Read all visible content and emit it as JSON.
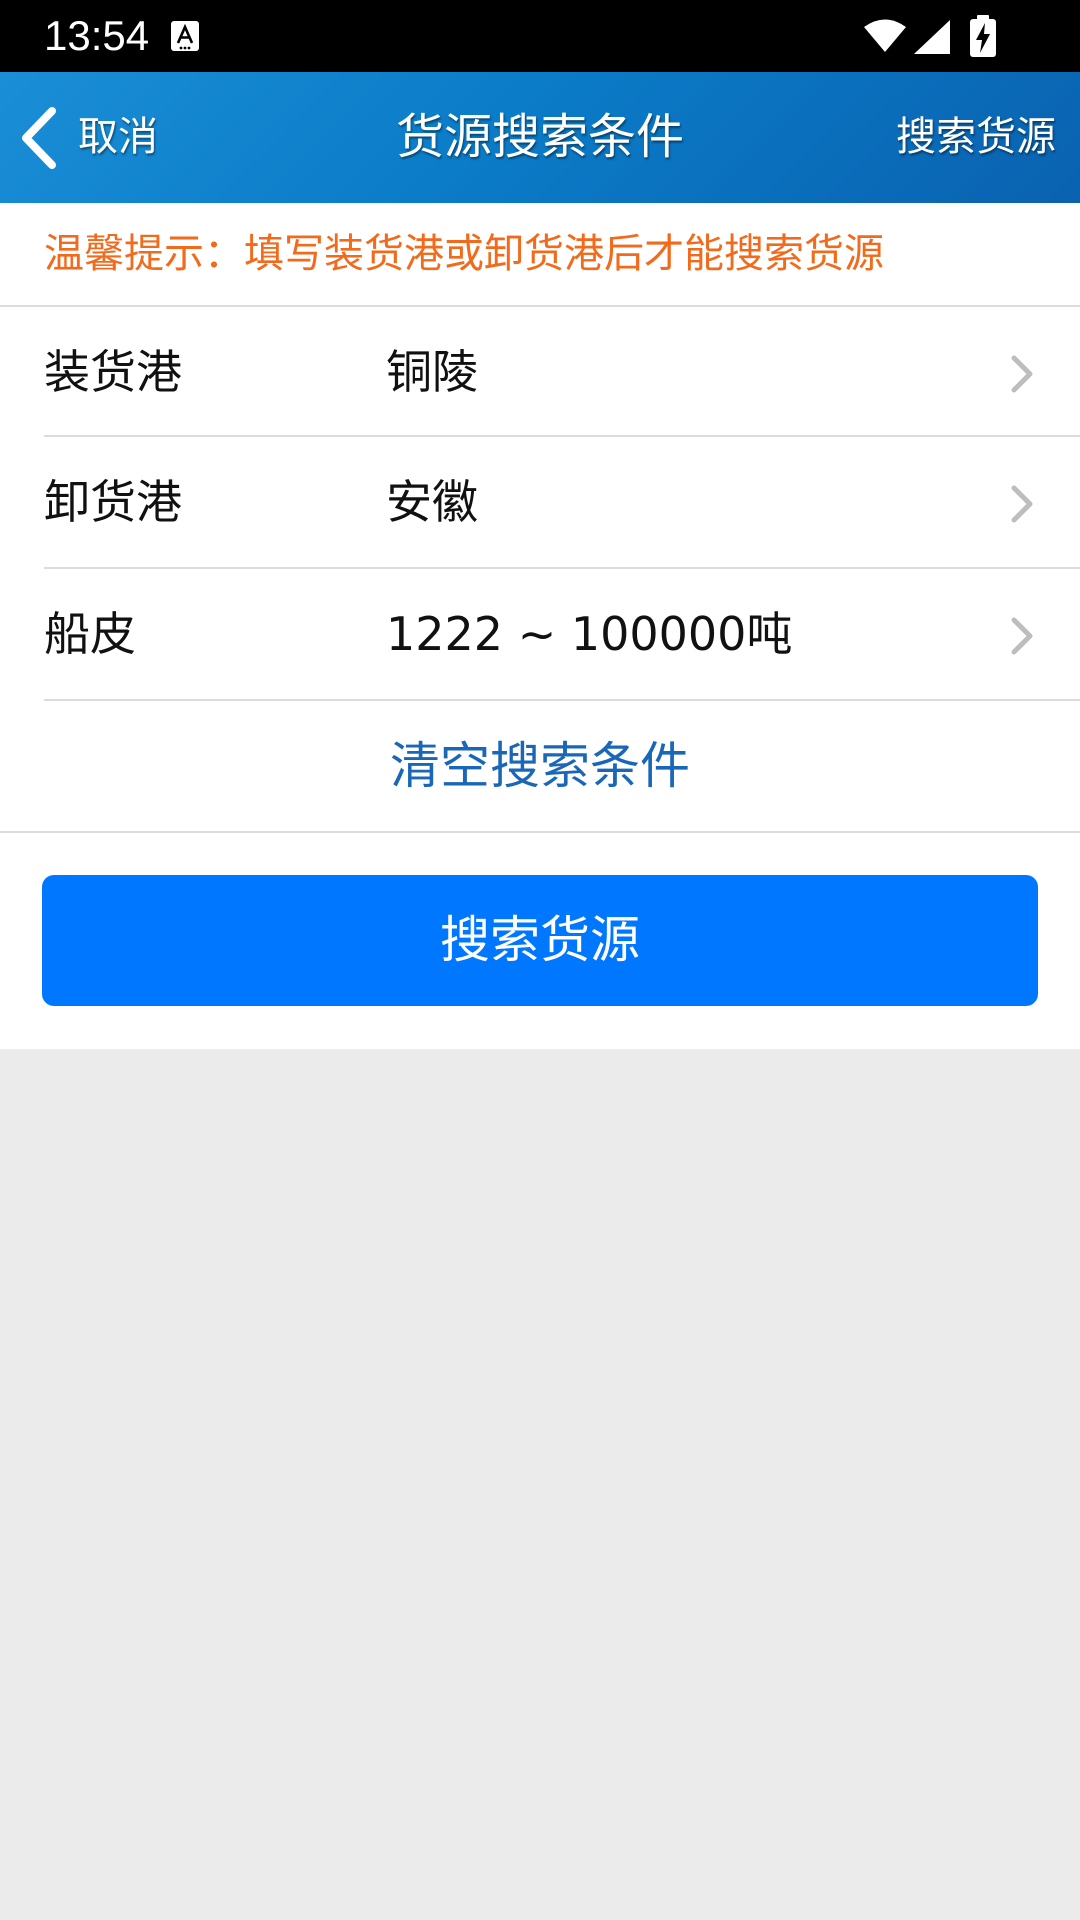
{
  "status_bar": {
    "time": "13:54",
    "icons": [
      "text-a-icon",
      "wifi-icon",
      "cell-signal-icon",
      "battery-charging-icon"
    ]
  },
  "header": {
    "back_label": "取消",
    "title": "货源搜索条件",
    "action_label": "搜索货源",
    "back_icon": "chevron-left-icon"
  },
  "tip": {
    "text": "温馨提示：填写装货港或卸货港后才能搜索货源"
  },
  "form": {
    "rows": [
      {
        "label": "装货港",
        "value": "铜陵",
        "icon": "chevron-right-icon"
      },
      {
        "label": "卸货港",
        "value": "安徽",
        "icon": "chevron-right-icon"
      },
      {
        "label": "船皮",
        "value": "1222 ~ 100000吨",
        "icon": "chevron-right-icon"
      }
    ],
    "clear_label": "清空搜索条件",
    "submit_label": "搜索货源"
  },
  "colors": {
    "header_gradient_start": "#1a8ed6",
    "header_gradient_end": "#0a62b0",
    "tip_orange": "#f26a1b",
    "link_blue": "#1a67b8",
    "button_blue": "#0077ff",
    "background_gray": "#ebebeb"
  }
}
